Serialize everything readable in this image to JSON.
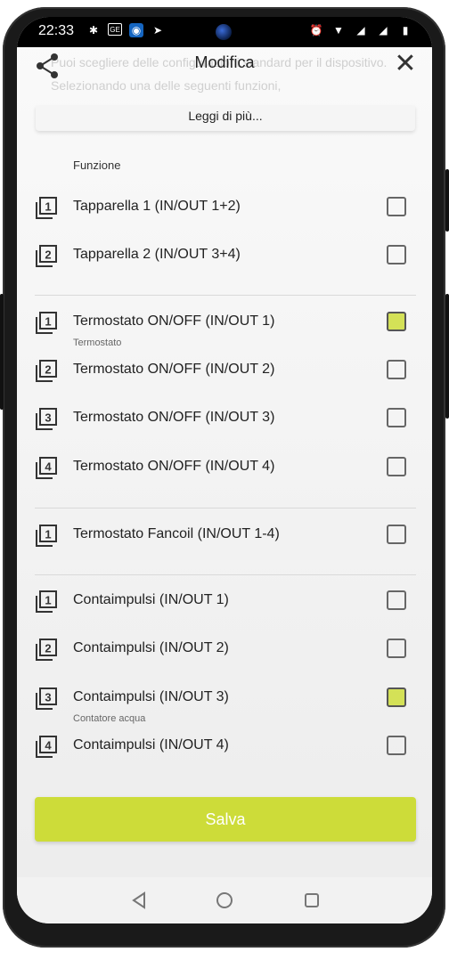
{
  "status": {
    "time": "22:33",
    "left_icons": [
      "slack-icon",
      "ge-icon",
      "app-icon",
      "play-icon"
    ],
    "right_icons": [
      "alarm-icon",
      "wifi-icon",
      "signal-off-icon",
      "signal-icon",
      "battery-icon"
    ]
  },
  "header": {
    "background_text": "Puoi scegliere delle configurazioni standard per il dispositivo. Selezionando una delle seguenti funzioni,",
    "title": "Modifica",
    "close": "✕"
  },
  "readmore": "Leggi di più...",
  "section_label": "Funzione",
  "rows": [
    {
      "num": "1",
      "label": "Tapparella 1 (IN/OUT 1+2)",
      "sub": "",
      "checked": false
    },
    {
      "num": "2",
      "label": "Tapparella 2 (IN/OUT 3+4)",
      "sub": "",
      "checked": false
    },
    {
      "num": "1",
      "label": "Termostato ON/OFF (IN/OUT 1)",
      "sub": "Termostato",
      "checked": true
    },
    {
      "num": "2",
      "label": "Termostato ON/OFF (IN/OUT 2)",
      "sub": "",
      "checked": false
    },
    {
      "num": "3",
      "label": "Termostato ON/OFF (IN/OUT 3)",
      "sub": "",
      "checked": false
    },
    {
      "num": "4",
      "label": "Termostato ON/OFF (IN/OUT 4)",
      "sub": "",
      "checked": false
    },
    {
      "num": "1",
      "label": "Termostato Fancoil (IN/OUT 1-4)",
      "sub": "",
      "checked": false
    },
    {
      "num": "1",
      "label": "Contaimpulsi (IN/OUT 1)",
      "sub": "",
      "checked": false
    },
    {
      "num": "2",
      "label": "Contaimpulsi (IN/OUT 2)",
      "sub": "",
      "checked": false
    },
    {
      "num": "3",
      "label": "Contaimpulsi (IN/OUT 3)",
      "sub": "Contatore acqua",
      "checked": true
    },
    {
      "num": "4",
      "label": "Contaimpulsi (IN/OUT 4)",
      "sub": "",
      "checked": false
    }
  ],
  "save_label": "Salva",
  "colors": {
    "accent": "#cddc39",
    "checked_fill": "#d4e157"
  }
}
